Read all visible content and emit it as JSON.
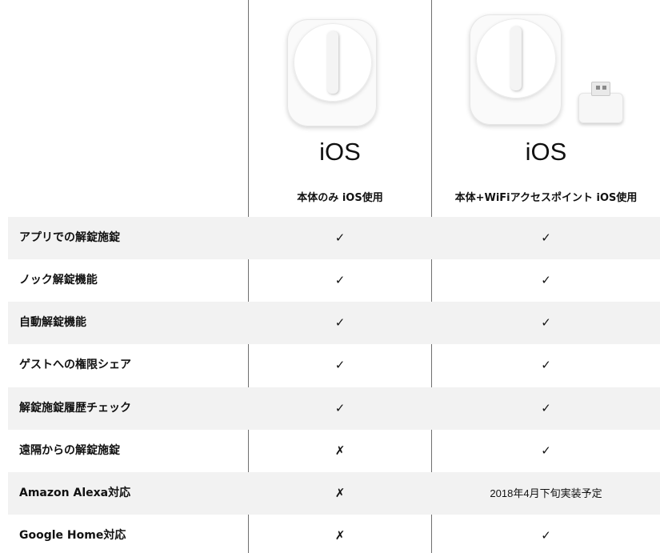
{
  "columns": [
    {
      "os": "iOS",
      "plan": "本体のみ iOS使用",
      "image": "smart-lock"
    },
    {
      "os": "iOS",
      "plan": "本体+WiFiアクセスポイント iOS使用",
      "image": "smart-lock-with-wifi-hub"
    }
  ],
  "rows": [
    {
      "label": "アプリでの解錠施錠",
      "c1": "✓",
      "c2": "✓",
      "shade": true
    },
    {
      "label": "ノック解錠機能",
      "c1": "✓",
      "c2": "✓",
      "shade": false
    },
    {
      "label": "自動解錠機能",
      "c1": "✓",
      "c2": "✓",
      "shade": true
    },
    {
      "label": "ゲストへの権限シェア",
      "c1": "✓",
      "c2": "✓",
      "shade": false
    },
    {
      "label": "解錠施錠履歴チェック",
      "c1": "✓",
      "c2": "✓",
      "shade": true
    },
    {
      "label": "遠隔からの解錠施錠",
      "c1": "✗",
      "c2": "✓",
      "shade": false
    },
    {
      "label": "Amazon Alexa対応",
      "c1": "✗",
      "c2": "2018年4月下旬実装予定",
      "shade": true
    },
    {
      "label": "Google Home対応",
      "c1": "✗",
      "c2": "✓",
      "shade": false
    }
  ]
}
